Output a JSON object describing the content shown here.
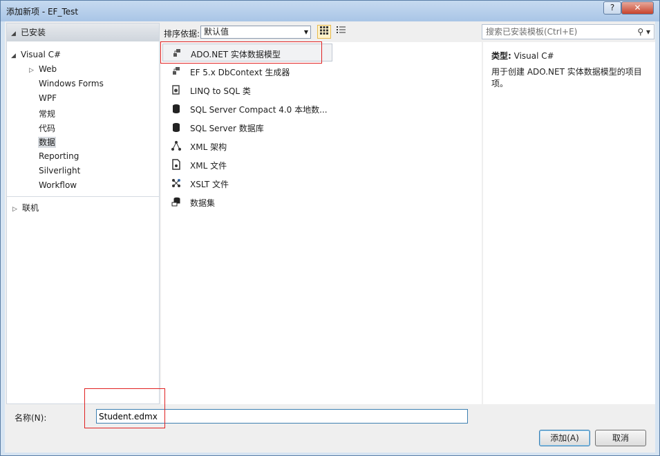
{
  "window": {
    "title": "添加新项 - EF_Test",
    "help_label": "?",
    "close_label": "✕"
  },
  "left_pane": {
    "header": "已安装",
    "tree": [
      {
        "label": "Visual C#",
        "arrow": "◢"
      },
      {
        "label": "Web",
        "arrow": "▷"
      },
      {
        "label": "Windows Forms"
      },
      {
        "label": "WPF"
      },
      {
        "label": "常规"
      },
      {
        "label": "代码"
      },
      {
        "label": "数据",
        "selected": true
      },
      {
        "label": "Reporting"
      },
      {
        "label": "Silverlight"
      },
      {
        "label": "Workflow"
      },
      {
        "label": "联机",
        "arrow": "▷"
      }
    ]
  },
  "toolbar": {
    "sort_label": "排序依据:",
    "sort_value": "默认值"
  },
  "search": {
    "placeholder": "搜索已安装模板(Ctrl+E)",
    "icon": "search-icon"
  },
  "templates": [
    {
      "label": "ADO.NET 实体数据模型",
      "icon": "entity-model-icon",
      "selected": true
    },
    {
      "label": "EF 5.x DbContext 生成器",
      "icon": "entity-model-icon"
    },
    {
      "label": "LINQ to SQL 类",
      "icon": "linq-icon"
    },
    {
      "label": "SQL Server Compact 4.0 本地数...",
      "icon": "database-icon"
    },
    {
      "label": "SQL Server 数据库",
      "icon": "database-icon"
    },
    {
      "label": "XML 架构",
      "icon": "xml-schema-icon"
    },
    {
      "label": "XML 文件",
      "icon": "xml-file-icon"
    },
    {
      "label": "XSLT 文件",
      "icon": "xslt-icon"
    },
    {
      "label": "数据集",
      "icon": "dataset-icon"
    }
  ],
  "details": {
    "type_label": "类型:",
    "type_value": "Visual C#",
    "description": "用于创建 ADO.NET 实体数据模型的项目项。"
  },
  "name_field": {
    "label": "名称(N):",
    "value": "Student.edmx"
  },
  "buttons": {
    "add": "添加(A)",
    "cancel": "取消"
  }
}
